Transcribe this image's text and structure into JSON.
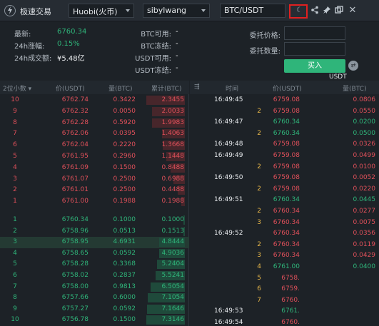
{
  "header": {
    "title": "极速交易",
    "exchange": "Huobi(火币)",
    "account": "sibylwang",
    "pair": "BTC/USDT"
  },
  "market": {
    "latest_label": "最新:",
    "latest_value": "6760.34",
    "change_label": "24h涨幅:",
    "change_value": "0.15%",
    "volume_label": "24h成交额:",
    "volume_value": "¥5.48亿"
  },
  "balances": [
    {
      "label": "BTC可用:",
      "value": "-"
    },
    {
      "label": "BTC冻结:",
      "value": "-"
    },
    {
      "label": "USDT可用:",
      "value": "-"
    },
    {
      "label": "USDT冻结:",
      "value": "-"
    }
  ],
  "order_form": {
    "price_label": "委托价格:",
    "qty_label": "委托数量:",
    "buy_label": "买入",
    "currency": "USDT"
  },
  "book": {
    "headers": {
      "precision": "2位小数",
      "price": "价(USDT)",
      "qty": "量(BTC)",
      "total": "累计(BTC)"
    },
    "asks": [
      {
        "idx": "10",
        "price": "6762.74",
        "qty": "0.3422",
        "total": "2.3455"
      },
      {
        "idx": "9",
        "price": "6762.32",
        "qty": "0.0050",
        "total": "2.0033"
      },
      {
        "idx": "8",
        "price": "6762.28",
        "qty": "0.5920",
        "total": "1.9983"
      },
      {
        "idx": "7",
        "price": "6762.06",
        "qty": "0.0395",
        "total": "1.4063"
      },
      {
        "idx": "6",
        "price": "6762.04",
        "qty": "0.2220",
        "total": "1.3668"
      },
      {
        "idx": "5",
        "price": "6761.95",
        "qty": "0.2960",
        "total": "1.1448"
      },
      {
        "idx": "4",
        "price": "6761.09",
        "qty": "0.1500",
        "total": "0.8488"
      },
      {
        "idx": "3",
        "price": "6761.07",
        "qty": "0.2500",
        "total": "0.6988"
      },
      {
        "idx": "2",
        "price": "6761.01",
        "qty": "0.2500",
        "total": "0.4488"
      },
      {
        "idx": "1",
        "price": "6761.00",
        "qty": "0.1988",
        "total": "0.1988"
      }
    ],
    "bids": [
      {
        "idx": "1",
        "price": "6760.34",
        "qty": "0.1000",
        "total": "0.1000"
      },
      {
        "idx": "2",
        "price": "6758.96",
        "qty": "0.0513",
        "total": "0.1513"
      },
      {
        "idx": "3",
        "price": "6758.95",
        "qty": "4.6931",
        "total": "4.8444"
      },
      {
        "idx": "4",
        "price": "6758.65",
        "qty": "0.0592",
        "total": "4.9036"
      },
      {
        "idx": "5",
        "price": "6758.28",
        "qty": "0.3368",
        "total": "5.2404"
      },
      {
        "idx": "6",
        "price": "6758.02",
        "qty": "0.2837",
        "total": "5.5241"
      },
      {
        "idx": "7",
        "price": "6758.00",
        "qty": "0.9813",
        "total": "6.5054"
      },
      {
        "idx": "8",
        "price": "6757.66",
        "qty": "0.6000",
        "total": "7.1054"
      },
      {
        "idx": "9",
        "price": "6757.27",
        "qty": "0.0592",
        "total": "7.1646"
      },
      {
        "idx": "10",
        "price": "6756.78",
        "qty": "0.1500",
        "total": "7.3146"
      }
    ]
  },
  "trades": {
    "headers": {
      "time": "时间",
      "price": "价(USDT)",
      "qty": "量(BTC)"
    },
    "rows": [
      {
        "time": "16:49:45",
        "dir": "",
        "price": "6759.08",
        "qty": "0.0806",
        "side": "sell"
      },
      {
        "time": "",
        "dir": "2",
        "price": "6759.08",
        "qty": "0.0550",
        "side": "sell"
      },
      {
        "time": "16:49:47",
        "dir": "",
        "price": "6760.34",
        "qty": "0.0200",
        "side": "buy"
      },
      {
        "time": "",
        "dir": "2",
        "price": "6760.34",
        "qty": "0.0500",
        "side": "buy"
      },
      {
        "time": "16:49:48",
        "dir": "",
        "price": "6759.08",
        "qty": "0.0326",
        "side": "sell"
      },
      {
        "time": "16:49:49",
        "dir": "",
        "price": "6759.08",
        "qty": "0.0499",
        "side": "sell"
      },
      {
        "time": "",
        "dir": "2",
        "price": "6759.08",
        "qty": "0.0100",
        "side": "sell"
      },
      {
        "time": "16:49:50",
        "dir": "",
        "price": "6759.08",
        "qty": "0.0052",
        "side": "sell"
      },
      {
        "time": "",
        "dir": "2",
        "price": "6759.08",
        "qty": "0.0220",
        "side": "sell"
      },
      {
        "time": "16:49:51",
        "dir": "",
        "price": "6760.34",
        "qty": "0.0445",
        "side": "buy"
      },
      {
        "time": "",
        "dir": "2",
        "price": "6760.34",
        "qty": "0.0277",
        "side": "sell"
      },
      {
        "time": "",
        "dir": "3",
        "price": "6760.34",
        "qty": "0.0075",
        "side": "sell"
      },
      {
        "time": "16:49:52",
        "dir": "",
        "price": "6760.34",
        "qty": "0.0356",
        "side": "sell"
      },
      {
        "time": "",
        "dir": "2",
        "price": "6760.34",
        "qty": "0.0119",
        "side": "sell"
      },
      {
        "time": "",
        "dir": "3",
        "price": "6760.34",
        "qty": "0.0429",
        "side": "sell"
      },
      {
        "time": "",
        "dir": "4",
        "price": "6761.00",
        "qty": "0.0400",
        "side": "buy"
      },
      {
        "time": "",
        "dir": "5",
        "price": "6758.",
        "qty": "",
        "side": "sell"
      },
      {
        "time": "",
        "dir": "6",
        "price": "6759.",
        "qty": "",
        "side": "sell"
      },
      {
        "time": "",
        "dir": "7",
        "price": "6760.",
        "qty": "",
        "side": "sell"
      },
      {
        "time": "16:49:53",
        "dir": "",
        "price": "6761.",
        "qty": "",
        "side": "buy"
      },
      {
        "time": "16:49:54",
        "dir": "",
        "price": "6760.",
        "qty": "",
        "side": "sell"
      }
    ]
  },
  "colors": {
    "buy": "#2fb57a",
    "sell": "#e0505a",
    "accent_border": "#e02020"
  }
}
